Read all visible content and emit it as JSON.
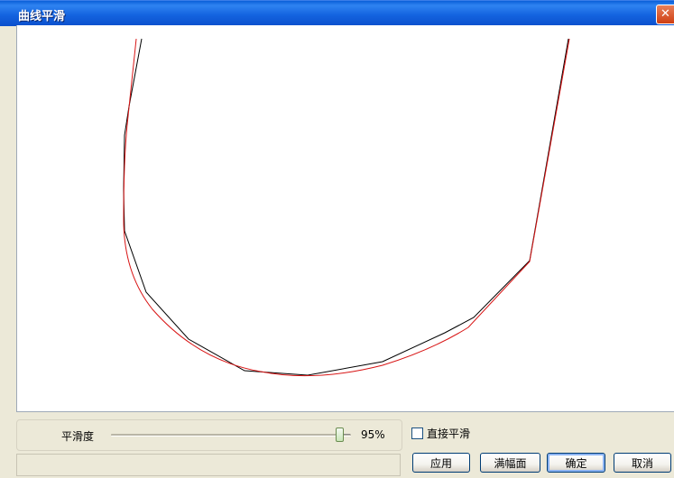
{
  "window": {
    "title": "曲线平滑",
    "close_glyph": "✕"
  },
  "controls": {
    "smoothness_label": "平滑度",
    "smoothness_value": "95%",
    "smoothness_level": 0.95,
    "direct_smooth_label": "直接平滑",
    "direct_smooth_checked": false
  },
  "buttons": {
    "apply": "应用",
    "fit": "满幅面",
    "ok": "确定",
    "cancel": "取消"
  },
  "colors": {
    "original_curve": "#000000",
    "smoothed_curve": "#d81414",
    "title_bar": "#0b5bd6"
  }
}
